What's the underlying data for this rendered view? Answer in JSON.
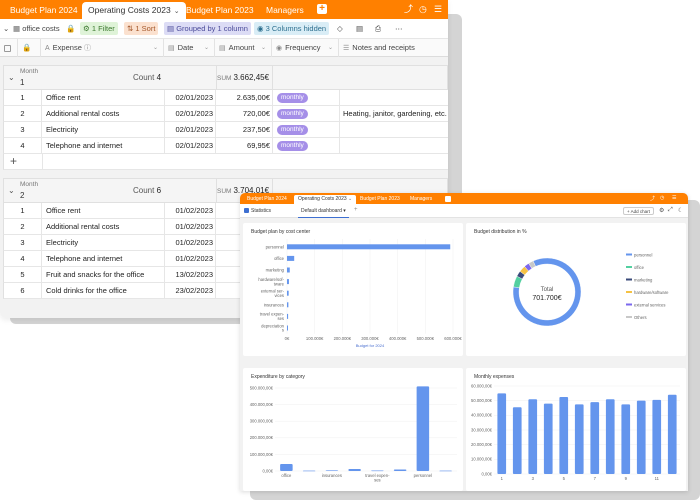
{
  "grid": {
    "tabs": [
      {
        "label": "Budget Plan 2024"
      },
      {
        "label": "Operating Costs 2023"
      },
      {
        "label": "Budget Plan 2023"
      },
      {
        "label": "Managers"
      }
    ],
    "toolbar": {
      "table_name": "office costs",
      "filter": "1 Filter",
      "sort": "1 Sort",
      "grouped": "Grouped by 1 column",
      "hidden": "3 Columns hidden"
    },
    "columns": {
      "expense": "Expense",
      "date": "Date",
      "amount": "Amount",
      "frequency": "Frequency",
      "notes": "Notes and receipts"
    },
    "groups": [
      {
        "label": "Month",
        "value": "1",
        "count_label": "Count",
        "count": "4",
        "sum_label": "SUM",
        "sum": "3.662,45€",
        "rows": [
          {
            "num": "1",
            "expense": "Office rent",
            "date": "02/01/2023",
            "amount": "2.635,00€",
            "frequency": "monthly",
            "notes": ""
          },
          {
            "num": "2",
            "expense": "Additional rental costs",
            "date": "02/01/2023",
            "amount": "720,00€",
            "frequency": "monthly",
            "notes": "Heating, janitor, gardening, etc."
          },
          {
            "num": "3",
            "expense": "Electricity",
            "date": "02/01/2023",
            "amount": "237,50€",
            "frequency": "monthly",
            "notes": ""
          },
          {
            "num": "4",
            "expense": "Telephone and internet",
            "date": "02/01/2023",
            "amount": "69,95€",
            "frequency": "monthly",
            "notes": ""
          }
        ]
      },
      {
        "label": "Month",
        "value": "2",
        "count_label": "Count",
        "count": "6",
        "sum_label": "SUM",
        "sum": "3.704,01€",
        "rows": [
          {
            "num": "1",
            "expense": "Office rent",
            "date": "01/02/2023"
          },
          {
            "num": "2",
            "expense": "Additional rental costs",
            "date": "01/02/2023"
          },
          {
            "num": "3",
            "expense": "Electricity",
            "date": "01/02/2023"
          },
          {
            "num": "4",
            "expense": "Telephone and internet",
            "date": "01/02/2023"
          },
          {
            "num": "5",
            "expense": "Fruit and snacks for the office",
            "date": "13/02/2023"
          },
          {
            "num": "6",
            "expense": "Cold drinks for the office",
            "date": "23/02/2023"
          }
        ]
      }
    ]
  },
  "stats": {
    "tabs": [
      {
        "label": "Budget Plan 2024"
      },
      {
        "label": "Operating Costs 2023"
      },
      {
        "label": "Budget Plan 2023"
      },
      {
        "label": "Managers"
      }
    ],
    "page_label": "Statistics",
    "dashboard_label": "Default dashboard",
    "add_chart": "Add chart",
    "panels": {
      "p1_title": "Budget plan by cost center",
      "p2_title": "Budget distribution in %",
      "p3_title": "Expenditure by category",
      "p4_title": "Monthly expenses"
    },
    "donut_label": "Total",
    "donut_value": "701.700€"
  },
  "chart_data": [
    {
      "type": "bar",
      "orientation": "horizontal",
      "title": "Budget plan by cost center",
      "categories": [
        "personnel",
        "office",
        "marketing",
        "hardware/software",
        "external services",
        "insurances",
        "travel expenses",
        "depreciation"
      ],
      "category_labels": [
        [
          "personnel"
        ],
        [
          "office"
        ],
        [
          "marketing"
        ],
        [
          "hardware/sof-",
          "tware"
        ],
        [
          "external ser-",
          "vices"
        ],
        [
          "insurances"
        ],
        [
          "travel expen-",
          "ses"
        ],
        [
          "depreciation",
          "s"
        ]
      ],
      "values": [
        590000,
        26000,
        10000,
        7000,
        6000,
        5000,
        4000,
        3000
      ],
      "xticks": [
        "0€",
        "100.000€",
        "200.000€",
        "300.000€",
        "400.000€",
        "500.000€",
        "600.000€"
      ],
      "xlim": [
        0,
        600000
      ],
      "xlabel": "Budget for 2024",
      "color": "#6495ed"
    },
    {
      "type": "pie",
      "title": "Budget distribution in %",
      "donut": true,
      "categories": [
        "personnel",
        "office",
        "marketing",
        "hardware/software",
        "external services",
        "Others"
      ],
      "values": [
        84.1,
        5.3,
        2.7,
        3.1,
        2.4,
        2.4
      ],
      "colors": [
        "#6495ed",
        "#53d0a0",
        "#3a4a7a",
        "#f5c244",
        "#7b68ee",
        "#c8c8c8"
      ],
      "legend": "right"
    },
    {
      "type": "bar",
      "title": "Expenditure by category",
      "categories": [
        "office",
        "",
        "insurances",
        "",
        "travel expenses",
        "",
        "personnel",
        ""
      ],
      "category_labels": [
        [
          "office"
        ],
        [],
        [
          "insurances"
        ],
        [],
        [
          "travel expen-",
          "ses"
        ],
        [],
        [
          "personnel"
        ],
        []
      ],
      "values": [
        42000,
        2000,
        4000,
        12000,
        3000,
        9000,
        510000,
        2000
      ],
      "yticks": [
        "0,00€",
        "100.000,00€",
        "200.000,00€",
        "300.000,00€",
        "400.000,00€",
        "500.000,00€"
      ],
      "ylim": [
        0,
        500000
      ],
      "color": "#6495ed"
    },
    {
      "type": "bar",
      "title": "Monthly expenses",
      "categories": [
        "1",
        "2",
        "3",
        "4",
        "5",
        "6",
        "7",
        "8",
        "9",
        "10",
        "11",
        "12"
      ],
      "tick_labels": [
        "1",
        "3",
        "5",
        "7",
        "9",
        "11"
      ],
      "values": [
        55000,
        45500,
        51000,
        48000,
        52500,
        47500,
        49000,
        51000,
        47500,
        50000,
        50500,
        54000
      ],
      "yticks": [
        "0,00€",
        "10.000,00€",
        "20.000,00€",
        "30.000,00€",
        "40.000,00€",
        "50.000,00€",
        "60.000,00€"
      ],
      "ylim": [
        0,
        60000
      ],
      "color": "#6495ed"
    }
  ]
}
